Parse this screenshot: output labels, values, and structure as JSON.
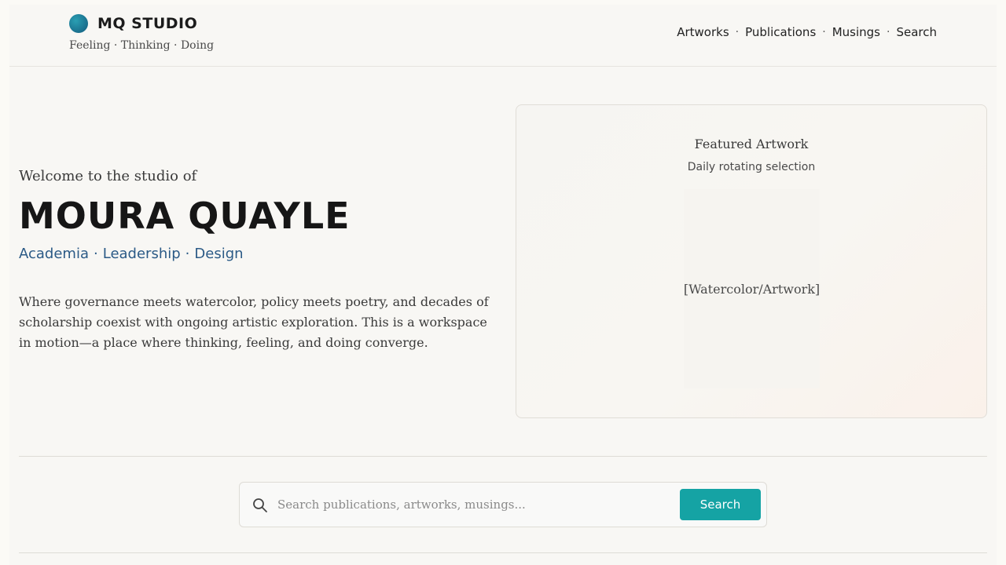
{
  "brand": {
    "name": "MQ STUDIO",
    "tagline": "Feeling · Thinking · Doing"
  },
  "nav": {
    "items": [
      {
        "label": "Artworks"
      },
      {
        "label": "Publications"
      },
      {
        "label": "Musings"
      },
      {
        "label": "Search"
      }
    ],
    "separator": "·"
  },
  "hero": {
    "welcome": "Welcome to the studio of",
    "name": "MOURA QUAYLE",
    "roles": [
      "Academia",
      "Leadership",
      "Design"
    ],
    "role_separator": "·",
    "description": "Where governance meets watercolor, policy meets poetry, and decades of scholarship coexist with ongoing artistic exploration. This is a workspace in motion—a place where thinking, feeling, and doing converge."
  },
  "featured": {
    "title": "Featured Artwork",
    "subtitle": "Daily rotating selection",
    "placeholder": "[Watercolor/Artwork]"
  },
  "search": {
    "placeholder": "Search publications, artworks, musings...",
    "value": "",
    "button_label": "Search"
  },
  "colors": {
    "accent": "#15a3a4",
    "role_text": "#2b5a86",
    "logo": "#1a6f8d",
    "background": "#f8f7f4"
  }
}
